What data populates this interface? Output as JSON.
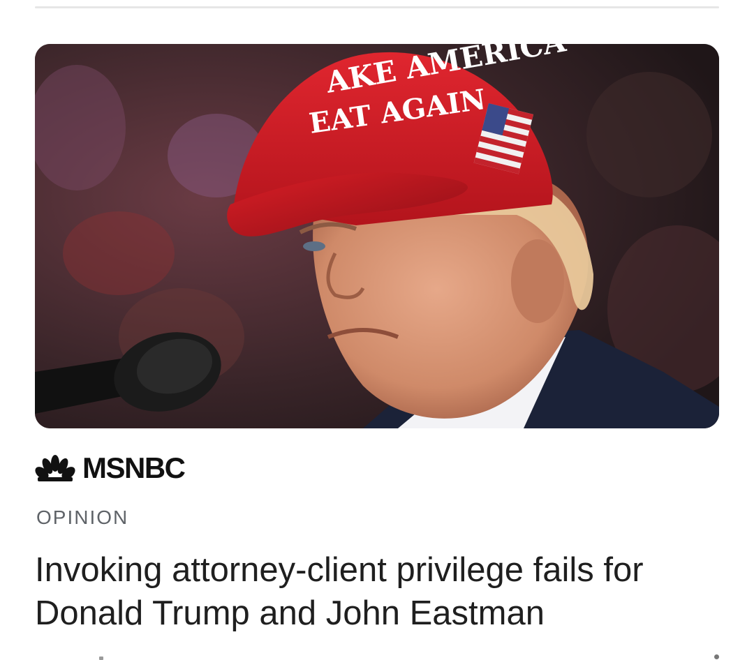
{
  "article": {
    "image": {
      "description_icon": "article-photo",
      "cap_text_line1": "AKE AMERICA",
      "cap_text_line2": "EAT AGAIN"
    },
    "source": {
      "name": "MSNBC",
      "logo_icon": "nbc-peacock-icon"
    },
    "section_label": "OPINION",
    "headline": "Invoking attorney-client privilege fails for Donald Trump and John Eastman",
    "more_icon": "more-vert-icon"
  },
  "colors": {
    "background": "#ffffff",
    "headline": "#1f1f1f",
    "section_label": "#5f6368",
    "divider": "#e6e6e6",
    "cap_red": "#d3202a"
  }
}
